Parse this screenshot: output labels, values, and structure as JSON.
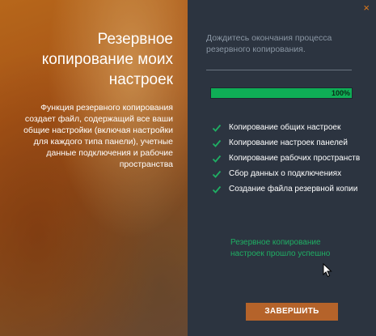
{
  "left": {
    "title": "Резервное копирование моих настроек",
    "description": "Функция резервного копирования создает файл, содержащий все ваши общие настройки (включая настройки для каждого типа панели), учетные данные подключения и рабочие пространства"
  },
  "right": {
    "close_icon": "×",
    "wait_text": "Дождитесь окончания процесса резервного копирования.",
    "progress": {
      "value": 100,
      "label": "100%",
      "fill_color": "#0fae56"
    },
    "steps": [
      {
        "label": "Копирование общих настроек",
        "icon": "check-icon"
      },
      {
        "label": "Копирование настроек панелей",
        "icon": "check-icon"
      },
      {
        "label": "Копирование рабочих пространств",
        "icon": "check-icon"
      },
      {
        "label": "Сбор данных о подключениях",
        "icon": "check-icon"
      },
      {
        "label": "Создание файла резервной копии",
        "icon": "check-icon"
      }
    ],
    "success_text": "Резервное копирование настроек прошло успешно",
    "finish_button": "ЗАВЕРШИТЬ"
  },
  "colors": {
    "accent": "#b5632a",
    "success": "#1fae63",
    "panel_bg": "#2c3440",
    "close": "#e07a1a"
  }
}
